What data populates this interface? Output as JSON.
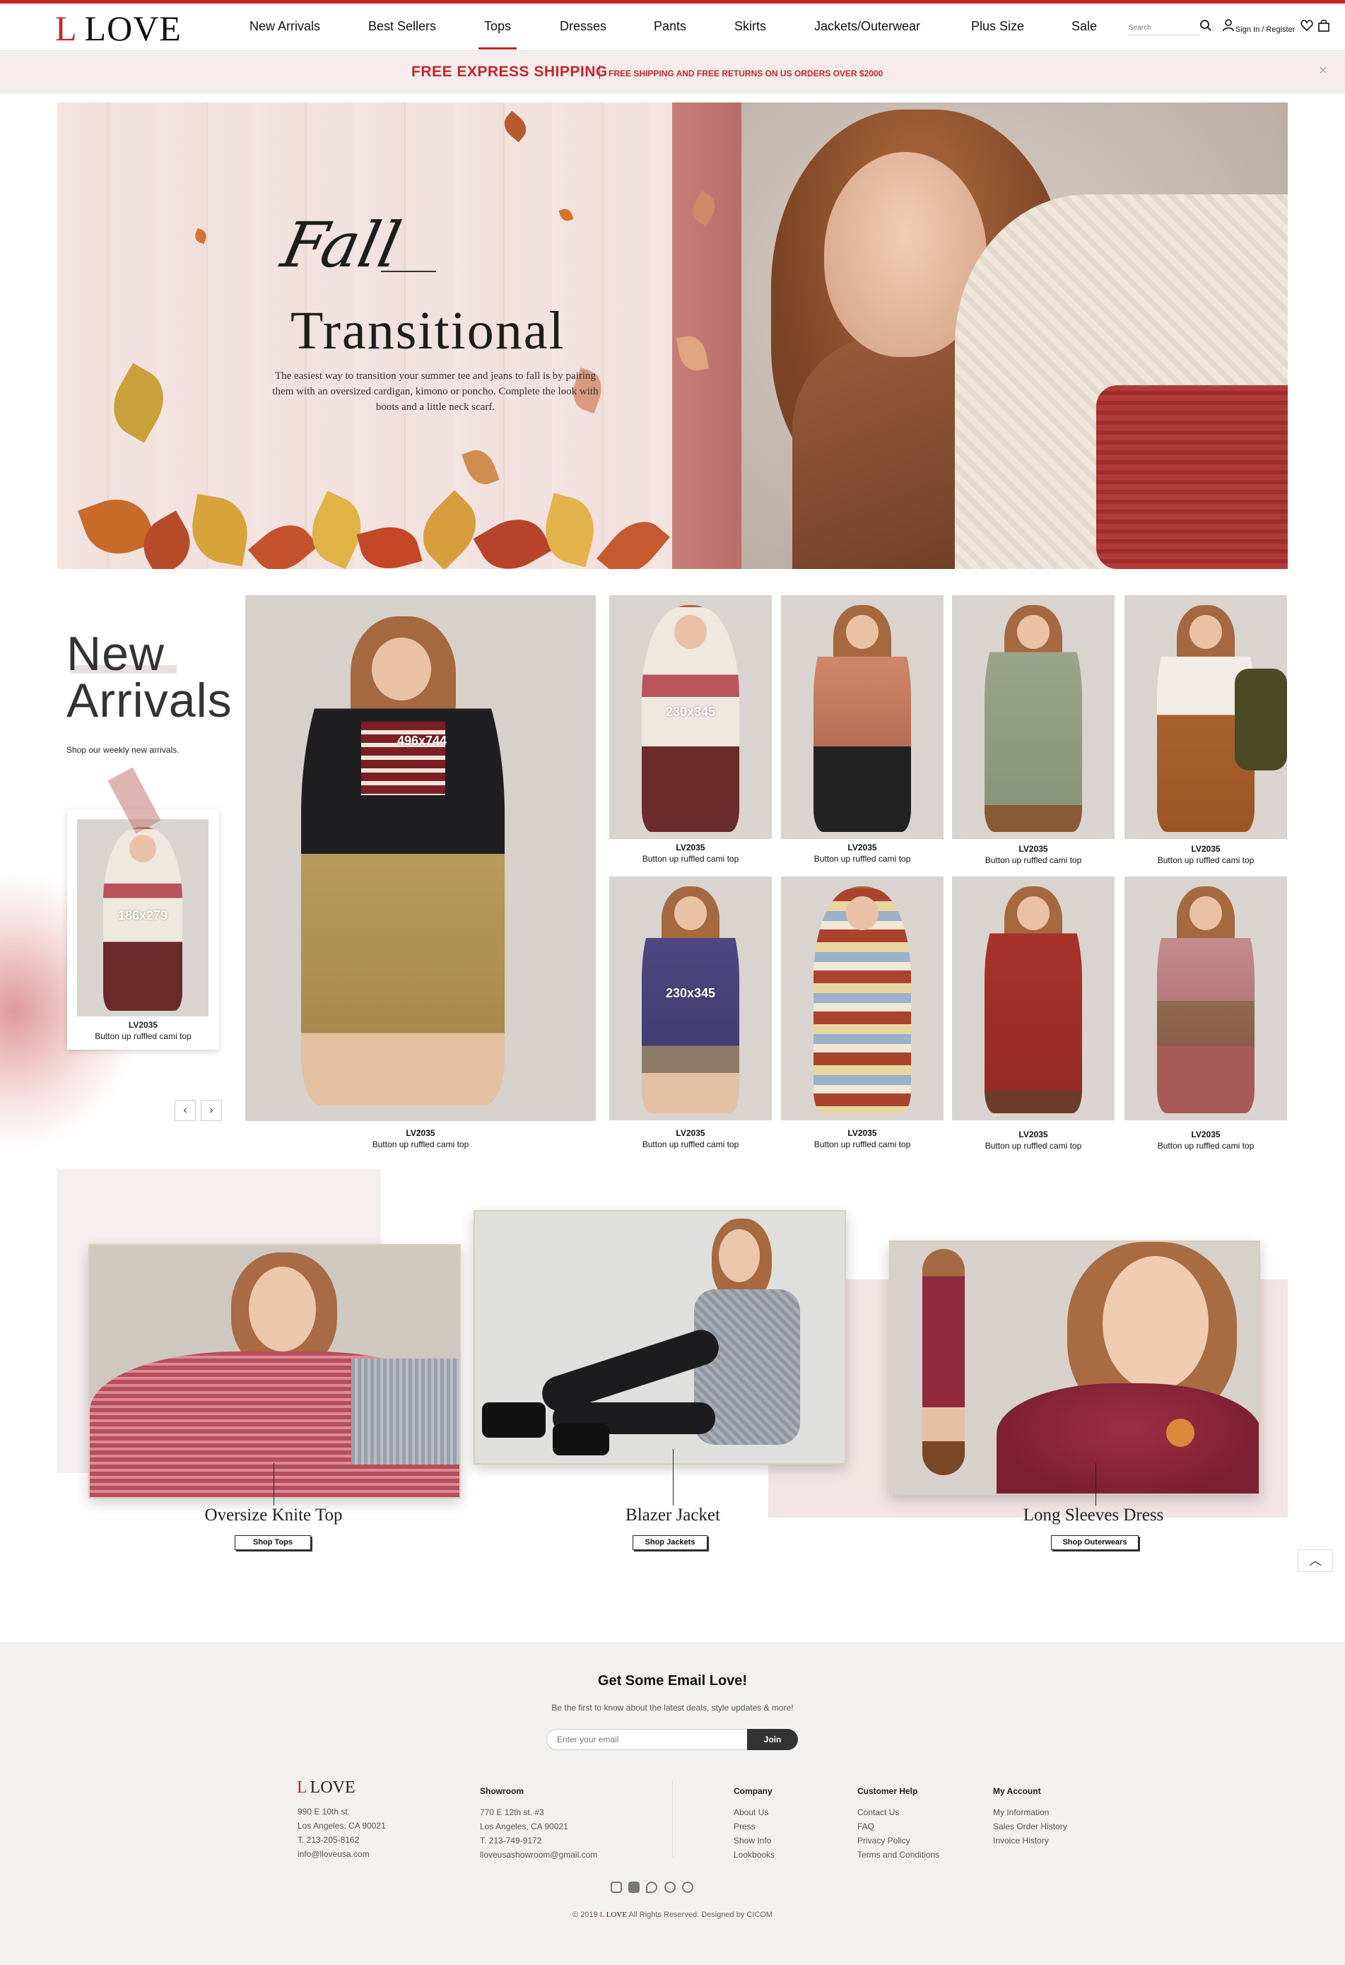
{
  "brand": {
    "logo_letter": "L",
    "logo_word": "LOVE",
    "accent": "#c3272b"
  },
  "nav": {
    "items": [
      "New Arrivals",
      "Best Sellers",
      "Tops",
      "Dresses",
      "Pants",
      "Skirts",
      "Jackets/Outerwear",
      "Plus Size",
      "Sale"
    ],
    "active": "Tops",
    "search_placeholder": "Search",
    "sign_in": "Sign In / Register"
  },
  "promo": {
    "main": "FREE EXPRESS SHIPPING",
    "sub": "FREE SHIPPING AND FREE RETURNS ON US ORDERS OVER $2000",
    "close": "×"
  },
  "hero": {
    "script": "Fall",
    "title": "Transitional",
    "text": "The easiest way to transition your summer tee and jeans to fall is by pairing them with an oversized cardigan, kimono or poncho. Complete the look with boots and a little neck scarf."
  },
  "new_arrivals": {
    "title_line1": "New",
    "title_line2": "Arrivals",
    "subtitle": "Shop our weekly new arrivals.",
    "polaroid": {
      "dim": "186x279",
      "code": "LV2035",
      "name": "Button up ruffled cami top"
    },
    "arrows": {
      "prev": "‹",
      "next": "›"
    },
    "main_product": {
      "dim": "496x744",
      "code": "LV2035",
      "name": "Button up ruffled cami top"
    },
    "grid": [
      {
        "dim": "230x345",
        "code": "LV2035",
        "name": "Button up ruffled cami top"
      },
      {
        "dim": "",
        "code": "LV2035",
        "name": "Button up ruffled cami top"
      },
      {
        "dim": "",
        "code": "LV2035",
        "name": "Button up ruffled cami top"
      },
      {
        "dim": "",
        "code": "LV2035",
        "name": "Button up ruffled cami top"
      },
      {
        "dim": "230x345",
        "code": "LV2035",
        "name": "Button up ruffled cami top"
      },
      {
        "dim": "",
        "code": "LV2035",
        "name": "Button up ruffled cami top"
      },
      {
        "dim": "",
        "code": "LV2035",
        "name": "Button up ruffled cami top"
      },
      {
        "dim": "",
        "code": "LV2035",
        "name": "Button up ruffled cami top"
      }
    ]
  },
  "featured": [
    {
      "title": "Oversize Knite Top",
      "button": "Shop Tops"
    },
    {
      "title": "Blazer Jacket",
      "button": "Shop Jackets"
    },
    {
      "title": "Long Sleeves Dress",
      "button": "Shop Outerwears"
    }
  ],
  "scroll_top": "︿",
  "footer": {
    "title": "Get Some Email Love!",
    "subtitle": "Be the first to know about the latest deals, style updates & more!",
    "email_placeholder": "Enter your email",
    "join": "Join",
    "address": {
      "line1": "990 E 10th st.",
      "line2": "Los Angeles, CA 90021",
      "phone": "T. 213-205-8162",
      "email": "info@lloveusa.com"
    },
    "showroom": {
      "heading": "Showroom",
      "line1": "770 E 12th st. #3",
      "line2": "Los Angeles, CA 90021",
      "phone": "T. 213-749-9172",
      "email": "lloveusashowroom@gmail.com"
    },
    "company": {
      "heading": "Company",
      "links": [
        "About Us",
        "Press",
        "Show Info",
        "Lookbooks"
      ]
    },
    "help": {
      "heading": "Customer Help",
      "links": [
        "Contact Us",
        "FAQ",
        "Privacy Policy",
        "Terms and Conditions"
      ]
    },
    "account": {
      "heading": "My Account",
      "links": [
        "My Information",
        "Sales Order History",
        "Invoice History"
      ]
    },
    "social": [
      "instagram-icon",
      "facebook-icon",
      "twitter-icon",
      "pinterest-icon",
      "dribbble-icon"
    ],
    "copyright_pre": "© 2019",
    "copyright_post": "All Rights Reserved. Designed by CICOM"
  }
}
